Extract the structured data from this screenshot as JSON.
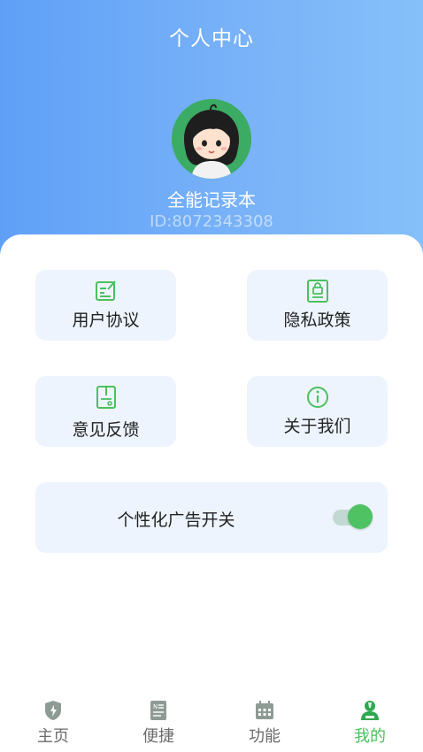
{
  "header": {
    "title": "个人中心",
    "username": "全能记录本",
    "user_id": "ID:8072343308"
  },
  "menu": [
    {
      "label": "用户协议",
      "icon": "edit-document-icon"
    },
    {
      "label": "隐私政策",
      "icon": "lock-document-icon"
    },
    {
      "label": "意见反馈",
      "icon": "feedback-document-icon"
    },
    {
      "label": "关于我们",
      "icon": "info-icon"
    }
  ],
  "ad_setting": {
    "label": "个性化广告开关",
    "enabled": true
  },
  "tabbar": [
    {
      "label": "主页",
      "icon": "shield-bolt-icon",
      "active": false
    },
    {
      "label": "便捷",
      "icon": "notes-icon",
      "active": false
    },
    {
      "label": "功能",
      "icon": "calendar-grid-icon",
      "active": false
    },
    {
      "label": "我的",
      "icon": "user-profile-icon",
      "active": true
    }
  ],
  "colors": {
    "accent": "#4bc05e",
    "header_gradient_start": "#5fa0f7",
    "header_gradient_end": "#86c0fa",
    "card_bg": "#eef4fd"
  }
}
